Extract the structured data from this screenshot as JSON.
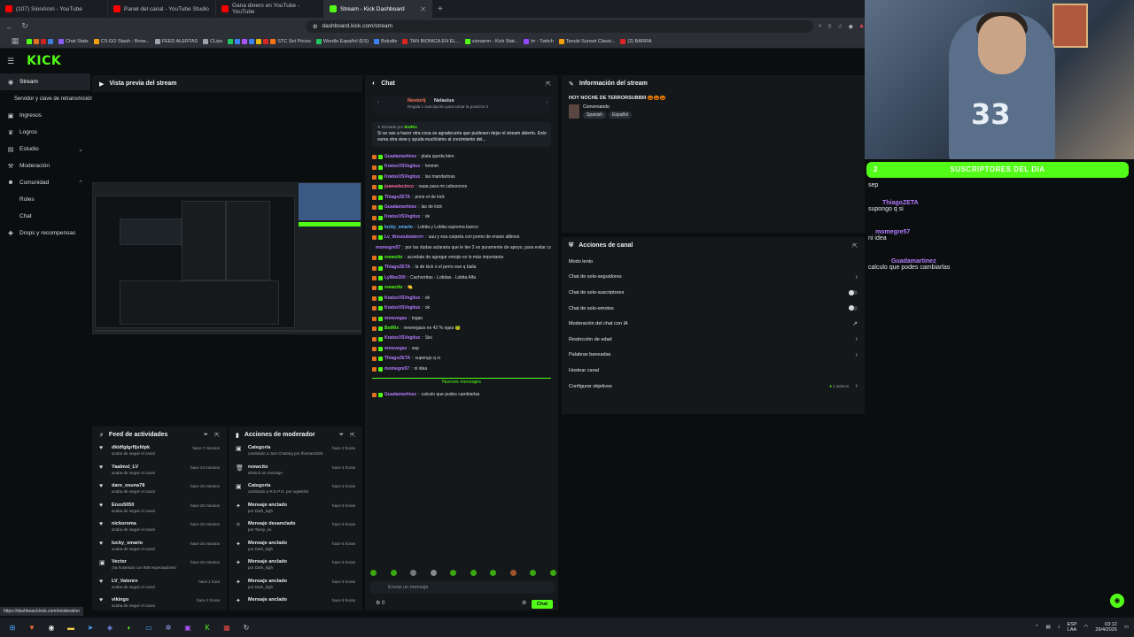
{
  "browser": {
    "tabs": [
      {
        "label": "(107) SionAron - YouTube",
        "color": "#ff0000"
      },
      {
        "label": "Panel del canal - YouTube Studio",
        "color": "#ff0000"
      },
      {
        "label": "Gana dinero en YouTube - YouTube",
        "color": "#ff0000"
      },
      {
        "label": "Stream - Kick Dashboard",
        "color": "#53fc18"
      }
    ],
    "url": "dashboard.kick.com/stream",
    "bookmarks": [
      "Chat Stats",
      "CS:GO Stash - Brow...",
      "FEED ALERTAS",
      "CLips",
      "STC Set Prices",
      "Wordle Español (ES)",
      "Boludle",
      "TAN BIONICA EN EL...",
      "sionaron - Kick Stat...",
      "trr - Twitch",
      "Tanuki Sunset Classi...",
      "(2) BARRA"
    ]
  },
  "app": {
    "logo": "KICK",
    "accent": "#53fc18"
  },
  "sidebar": {
    "items": [
      {
        "label": "Stream",
        "icon": "broadcast-icon"
      },
      {
        "label": "Servidor y clave de retransmisión"
      },
      {
        "label": "Ingresos",
        "icon": "wallet-icon"
      },
      {
        "label": "Logros",
        "icon": "trophy-icon"
      },
      {
        "label": "Estudio",
        "icon": "studio-icon"
      },
      {
        "label": "Moderación",
        "icon": "hammer-icon"
      },
      {
        "label": "Comunidad",
        "icon": "community-icon"
      },
      {
        "label": "Roles"
      },
      {
        "label": "Chat"
      },
      {
        "label": "Drops y recompensas",
        "icon": "gift-icon"
      }
    ]
  },
  "preview": {
    "title": "Vista previa del stream"
  },
  "chat": {
    "title": "Chat",
    "pinned_top": {
      "user1": "Nestorlj",
      "user2": "Nelasius",
      "note": "Regala 1 suscripción para tomar la posición 3"
    },
    "pinned": {
      "label": "Enviado por",
      "by": "BotRix",
      "text": "Si se van a hacer otra cosa se agradecería que pudiesen dejar el stream abierto. Esto suma otra view y ayuda muchísimo al crecimiento del..."
    },
    "messages": [
      {
        "user": "Guadamartinez",
        "text": "plata queda bien",
        "color": "#b47cff"
      },
      {
        "user": "KratosVSVegitux",
        "text": "hmmm",
        "color": "#b47cff"
      },
      {
        "user": "KratosVSVegitux",
        "text": "las mandarinas",
        "color": "#b47cff"
      },
      {
        "user": "juanselecinco",
        "text": "naaa para mi cabezones",
        "color": "#ff6b9b"
      },
      {
        "user": "ThiagoZETA",
        "text": "pone el de kick",
        "color": "#b47cff"
      },
      {
        "user": "Guadamartinez",
        "text": "las de kick",
        "color": "#b47cff"
      },
      {
        "user": "KratosVSVegitux",
        "text": "ok",
        "color": "#b47cff"
      },
      {
        "user": "lucky_smario",
        "text": "Lobita y Lobita suprema banco",
        "color": "#5fb8ff"
      },
      {
        "user": "Lv_thesouleaterrrr",
        "text": "uuu y esa carpeta con porno de enano albinos",
        "color": "#b47cff"
      },
      {
        "user": "momegre57",
        "text": "por las dudas aclararia que le tier 2 es puramente de apoyo, para evitar confusiones",
        "color": "#b47cff"
      },
      {
        "user": "reewcito",
        "text": "acordate de agregar emojis es lo más importante",
        "color": "#53fc18"
      },
      {
        "user": "ThiagoZETA",
        "text": "la de kick o el perro ese q baila",
        "color": "#b47cff"
      },
      {
        "user": "LyMax300",
        "text": "Cachorritas - Lobitas - Lobita Alfa",
        "color": "#b47cff"
      },
      {
        "user": "reewcito",
        "text": "🍋",
        "color": "#53fc18"
      },
      {
        "user": "KratosVSVegitux",
        "text": "ok",
        "color": "#b47cff"
      },
      {
        "user": "KratosVSVegitux",
        "text": "ok",
        "color": "#b47cff"
      },
      {
        "user": "mewvegas",
        "text": "togas",
        "color": "#b47cff"
      },
      {
        "user": "BotRix",
        "text": "newvegass es 42 % ogas 🐸",
        "color": "#53fc18"
      },
      {
        "user": "KratosVSVegitux",
        "text": "Sisi",
        "color": "#b47cff"
      },
      {
        "user": "mewvegas",
        "text": "sep",
        "color": "#b47cff"
      },
      {
        "user": "ThiagoZETA",
        "text": "supongo q si",
        "color": "#b47cff"
      },
      {
        "user": "momegre57",
        "text": "ni idea",
        "color": "#b47cff"
      }
    ],
    "new_messages_label": "Nuevos mensajes",
    "last_message": {
      "user": "Guadamartinez",
      "text": "calculo que podes cambiarlas"
    },
    "input_placeholder": "Enviar un mensaje",
    "send_label": "Chat",
    "counter": "0"
  },
  "stream_info": {
    "title": "Información del stream",
    "stream_title": "HOY NOCHE DE TERRORSUBBIII 🎃🎃🎃",
    "category": "Conversando",
    "tags": [
      "Spanish",
      "Español"
    ]
  },
  "channel_actions": {
    "title": "Acciones de canal",
    "rows": [
      {
        "label": "Modo lento",
        "control": "none"
      },
      {
        "label": "Chat de solo-seguidores",
        "control": "chevron"
      },
      {
        "label": "Chat de solo-suscriptores",
        "control": "toggle"
      },
      {
        "label": "Chat de solo-emotes",
        "control": "toggle"
      },
      {
        "label": "Moderación del chat con IA",
        "control": "external"
      },
      {
        "label": "Restricción de edad",
        "control": "chevron"
      },
      {
        "label": "Palabras baneadas",
        "control": "chevron"
      },
      {
        "label": "Hostear canal",
        "control": "none"
      },
      {
        "label": "Configurar objetivos",
        "control": "chevron",
        "status": "1 activos"
      }
    ]
  },
  "feed": {
    "title": "Feed de actividades",
    "rows": [
      {
        "name": "dkldfglgrfljsfdpk",
        "sub": "acaba de seguir el canal",
        "time": "hace 7 minutos"
      },
      {
        "name": "Yaalmxl_LV",
        "sub": "acaba de seguir el canal",
        "time": "hace 24 minutos"
      },
      {
        "name": "daro_osuna78",
        "sub": "acaba de seguir el canal",
        "time": "hace 25 minutos"
      },
      {
        "name": "Enzo5050",
        "sub": "acaba de seguir el canal",
        "time": "hace 25 minutos"
      },
      {
        "name": "nickoroma",
        "sub": "acaba de seguir el canal",
        "time": "hace 25 minutos"
      },
      {
        "name": "lucky_smario",
        "sub": "acaba de seguir el canal",
        "time": "hace 25 minutos"
      },
      {
        "name": "Vector",
        "sub": "¡ha hosteado con 808 espectadores!",
        "time": "hace 25 minutos"
      },
      {
        "name": "LV_Valenrn",
        "sub": "acaba de seguir el canal",
        "time": "hace 1 hora"
      },
      {
        "name": "vikingo",
        "sub": "acaba de seguir el canal",
        "time": "hace 2 horas"
      }
    ]
  },
  "mod_actions": {
    "title": "Acciones de moderador",
    "rows": [
      {
        "name": "Categoría",
        "sub": "cambiado a Just Chatting por thomas1825",
        "time": "hace 2 horas"
      },
      {
        "name": "reewcito",
        "sub": "eliminó un mensaje",
        "time": "hace 4 horas"
      },
      {
        "name": "Categoría",
        "sub": "cambiado a R.E.P.O. por ogsekick",
        "time": "hace 5 horas"
      },
      {
        "name": "Mensaje anclado",
        "sub": "por Dark_kigh",
        "time": "hace 5 horas"
      },
      {
        "name": "Mensaje desanclado",
        "sub": "por Tassy_ex",
        "time": "hace 5 horas"
      },
      {
        "name": "Mensaje anclado",
        "sub": "por Dark_kigh",
        "time": "hace 5 horas"
      },
      {
        "name": "Mensaje anclado",
        "sub": "por Dark_kigh",
        "time": "hace 5 horas"
      },
      {
        "name": "Mensaje anclado",
        "sub": "por Dark_kigh",
        "time": "hace 5 horas"
      },
      {
        "name": "Mensaje anclado",
        "sub": "",
        "time": "hace 5 horas"
      }
    ]
  },
  "overlay": {
    "subs_label": "SUSCRIPTORES DEL DIA",
    "subs_count": "2",
    "messages": [
      {
        "user": "",
        "text": "sep"
      },
      {
        "user": "ThiagoZETA",
        "text": "supongo q si"
      },
      {
        "user": "momegre57",
        "text": "ni idea"
      },
      {
        "user": "Guadamartinez",
        "text": "calculo que podes cambiarlas"
      }
    ]
  },
  "status_url": "https://dashboard.kick.com/moderation",
  "taskbar": {
    "lang": "ESP",
    "lang2": "LAA",
    "time": "03:12",
    "date": "29/4/2026"
  }
}
